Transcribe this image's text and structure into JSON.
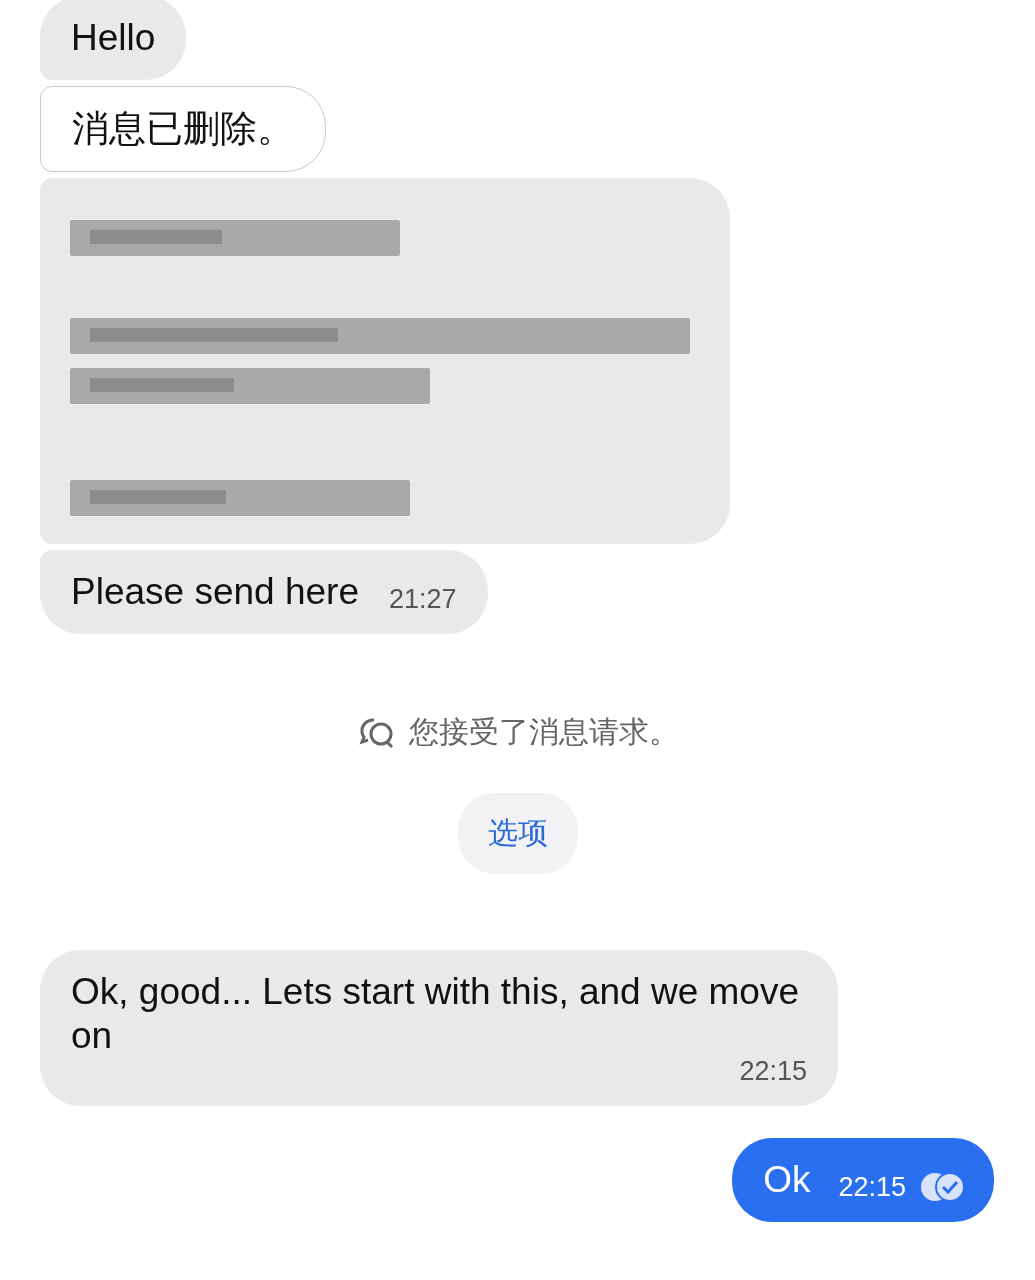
{
  "messages": [
    {
      "kind": "incoming",
      "text": "Hello"
    },
    {
      "kind": "deleted",
      "text": "消息已删除。"
    },
    {
      "kind": "redacted"
    },
    {
      "kind": "incoming",
      "text": "Please send here",
      "time": "21:27"
    },
    {
      "kind": "system",
      "text": "您接受了消息请求。"
    },
    {
      "kind": "action",
      "text": "选项"
    },
    {
      "kind": "incoming",
      "text": "Ok, good... Lets start with this, and we move on",
      "time": "22:15"
    },
    {
      "kind": "outgoing",
      "text": "Ok",
      "time": "22:15",
      "read": true
    }
  ]
}
